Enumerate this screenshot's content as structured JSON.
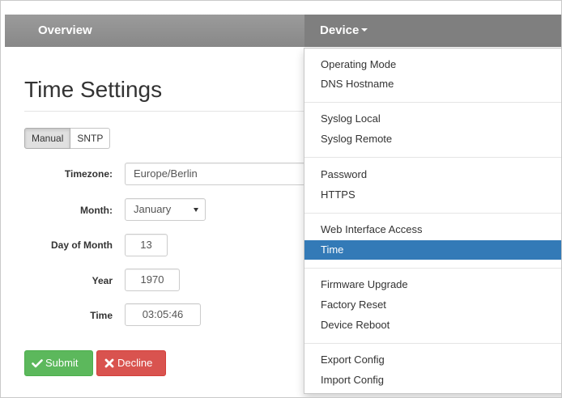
{
  "navbar": {
    "overview_label": "Overview",
    "device_label": "Device"
  },
  "page": {
    "title": "Time Settings"
  },
  "mode_toggle": {
    "manual_label": "Manual",
    "sntp_label": "SNTP",
    "selected": "Manual"
  },
  "form": {
    "timezone_label": "Timezone:",
    "timezone_value": "Europe/Berlin",
    "month_label": "Month:",
    "month_value": "January",
    "day_label": "Day of Month",
    "day_value": "13",
    "year_label": "Year",
    "year_value": "1970",
    "time_label": "Time",
    "time_value": "03:05:46"
  },
  "actions": {
    "submit_label": "Submit",
    "decline_label": "Decline",
    "submit_color": "#5cb85c",
    "decline_color": "#d9534f"
  },
  "device_menu": {
    "active_color": "#337ab7",
    "groups": [
      [
        "Operating Mode",
        "DNS Hostname"
      ],
      [
        "Syslog Local",
        "Syslog Remote"
      ],
      [
        "Password",
        "HTTPS"
      ],
      [
        "Web Interface Access",
        "Time"
      ],
      [
        "Firmware Upgrade",
        "Factory Reset",
        "Device Reboot"
      ],
      [
        "Export Config",
        "Import Config"
      ]
    ],
    "active_item": "Time"
  }
}
